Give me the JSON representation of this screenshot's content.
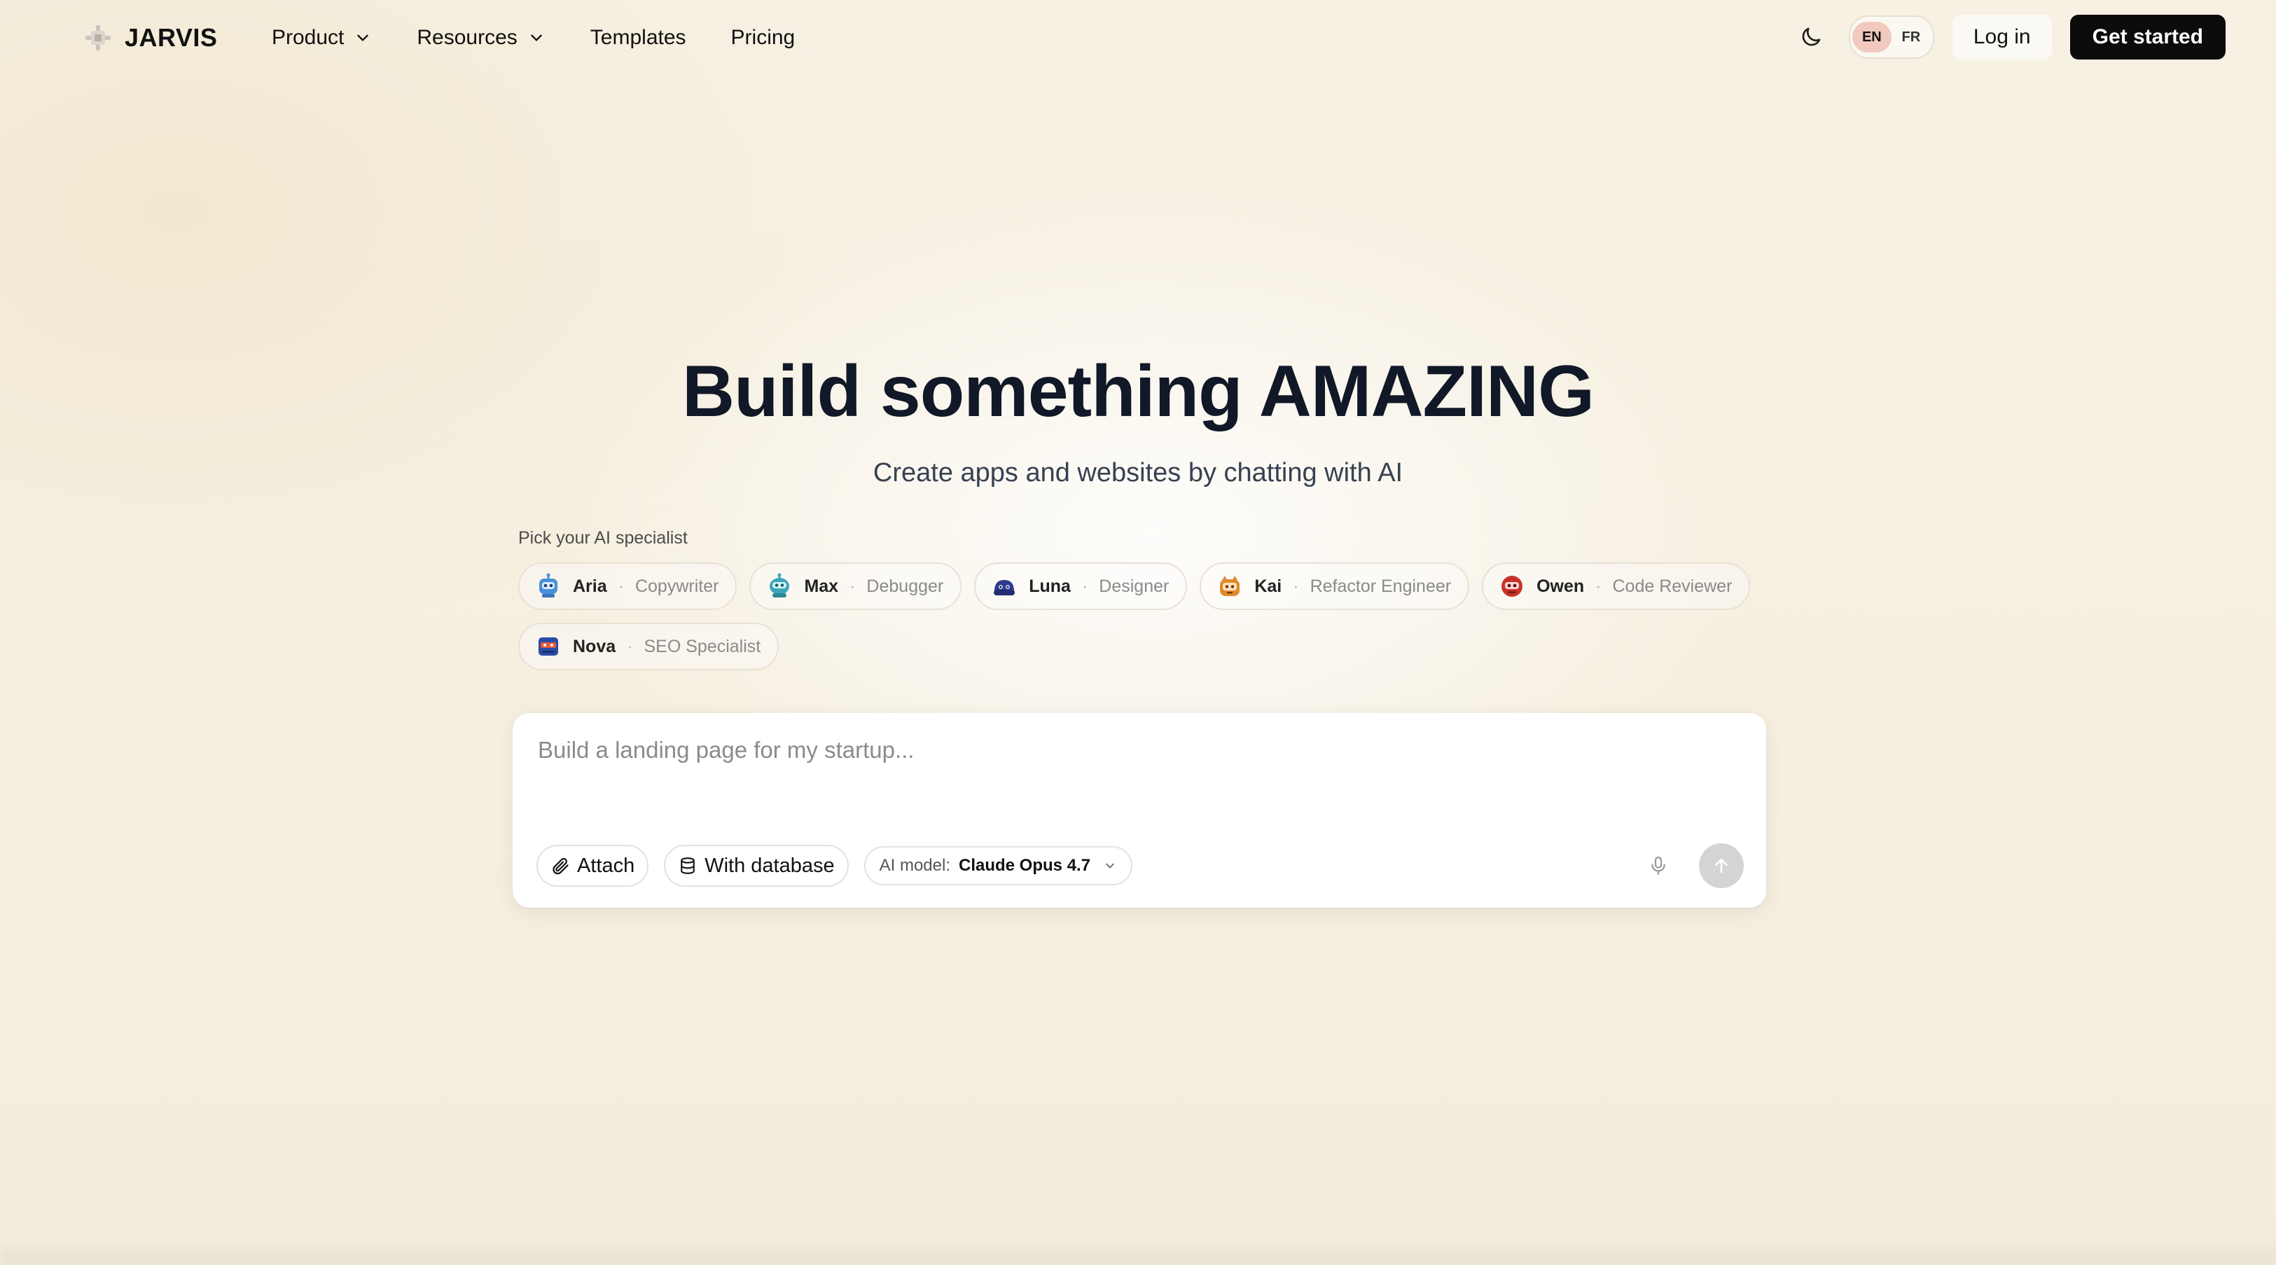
{
  "brand": {
    "name": "JARVIS",
    "logo_icon": "jarvis-logo-icon"
  },
  "nav": {
    "links": [
      {
        "label": "Product",
        "has_dropdown": true
      },
      {
        "label": "Resources",
        "has_dropdown": true
      },
      {
        "label": "Templates",
        "has_dropdown": false
      },
      {
        "label": "Pricing",
        "has_dropdown": false
      }
    ],
    "theme_icon": "moon-icon",
    "languages": [
      {
        "code": "EN",
        "active": true
      },
      {
        "code": "FR",
        "active": false
      }
    ],
    "login_label": "Log in",
    "cta_label": "Get started"
  },
  "hero": {
    "title": "Build something AMAZING",
    "subtitle": "Create apps and websites by chatting with AI"
  },
  "specialists": {
    "label": "Pick your AI specialist",
    "separator": "·",
    "items": [
      {
        "name": "Aria",
        "role": "Copywriter",
        "icon": "robot-avatar-blue",
        "color": "#4a90d9"
      },
      {
        "name": "Max",
        "role": "Debugger",
        "icon": "robot-avatar-teal",
        "color": "#3aa6b9"
      },
      {
        "name": "Luna",
        "role": "Designer",
        "icon": "robot-avatar-navy",
        "color": "#2f3a8f"
      },
      {
        "name": "Kai",
        "role": "Refactor Engineer",
        "icon": "robot-avatar-orange",
        "color": "#e08a2e"
      },
      {
        "name": "Owen",
        "role": "Code Reviewer",
        "icon": "robot-avatar-red",
        "color": "#c8322a"
      },
      {
        "name": "Nova",
        "role": "SEO Specialist",
        "icon": "robot-avatar-indigo",
        "color": "#2b4aa8"
      }
    ]
  },
  "prompt": {
    "placeholder": "Build a landing page for my startup...",
    "value": "",
    "attach_label": "Attach",
    "database_label": "With database",
    "model_label": "AI model:",
    "model_value": "Claude Opus 4.7",
    "mic_icon": "microphone-icon",
    "send_icon": "arrow-up-icon"
  },
  "colors": {
    "primary_button": "#0c0c0c",
    "active_language": "#f1c9bd",
    "send_button_disabled": "#d4d4d4"
  }
}
